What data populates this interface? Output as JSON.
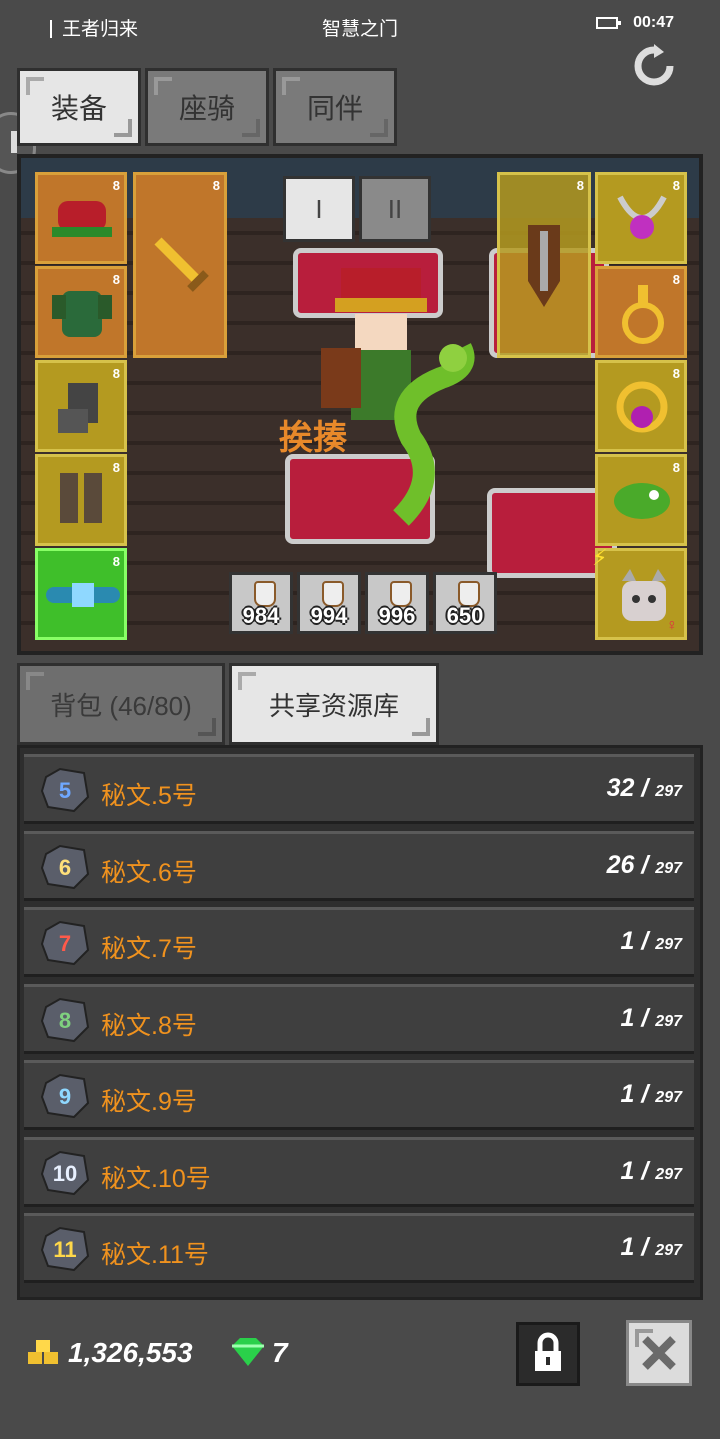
{
  "status": {
    "left_title": "王者归来",
    "center_title": "智慧之门",
    "time": "00:47"
  },
  "tabs": [
    {
      "label": "装备",
      "active": true
    },
    {
      "label": "座骑",
      "active": false
    },
    {
      "label": "同伴",
      "active": false
    }
  ],
  "scene": {
    "pager": [
      "I",
      "II"
    ],
    "float_text": "挨揍",
    "potions": [
      "984",
      "994",
      "996",
      "650"
    ],
    "lock_mark": "8"
  },
  "sub_tabs": [
    {
      "label": "背包 (46/80)",
      "active": false
    },
    {
      "label": "共享资源库",
      "active": true
    }
  ],
  "resources": [
    {
      "rune": "5",
      "name": "秘文.5号",
      "count": "32",
      "max": "297",
      "rune_color": "#6fa8ff"
    },
    {
      "rune": "6",
      "name": "秘文.6号",
      "count": "26",
      "max": "297",
      "rune_color": "#ffe07a"
    },
    {
      "rune": "7",
      "name": "秘文.7号",
      "count": "1",
      "max": "297",
      "rune_color": "#ff5a4a"
    },
    {
      "rune": "8",
      "name": "秘文.8号",
      "count": "1",
      "max": "297",
      "rune_color": "#7fd07f"
    },
    {
      "rune": "9",
      "name": "秘文.9号",
      "count": "1",
      "max": "297",
      "rune_color": "#8fd8ff"
    },
    {
      "rune": "10",
      "name": "秘文.10号",
      "count": "1",
      "max": "297",
      "rune_color": "#e8f0ff"
    },
    {
      "rune": "11",
      "name": "秘文.11号",
      "count": "1",
      "max": "297",
      "rune_color": "#ffd84a"
    }
  ],
  "footer": {
    "gold": "1,326,553",
    "gems": "7"
  },
  "colors": {
    "accent_orange": "#f0921e",
    "slot_orange": "#c0762a",
    "slot_yellow": "#b49a20",
    "slot_green": "#3fbf2a"
  }
}
